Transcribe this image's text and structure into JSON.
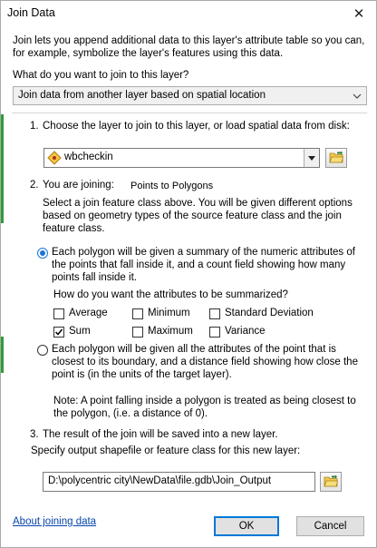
{
  "window": {
    "title": "Join Data",
    "close_glyph": "✕"
  },
  "intro": "Join lets you append additional data to this layer's attribute table so you can, for example, symbolize the layer's features using this data.",
  "question": "What do you want to join to this layer?",
  "join_type": {
    "selected": "Join data from another layer based on spatial location"
  },
  "step1": {
    "number": "1.",
    "label": "Choose the layer to join to this layer, or load spatial data from disk:",
    "layer": {
      "selected": "wbcheckin"
    }
  },
  "step2": {
    "number": "2.",
    "label": "You are joining:",
    "join_kind": "Points to Polygons",
    "description": "Select a join feature class above.  You will be given different options based on geometry types of the source feature class and the join feature class.",
    "option_summary": {
      "selected": true,
      "text": "Each polygon will be given a summary of the numeric attributes of the points that fall inside it, and a count field showing how many points fall inside it."
    },
    "summarize_question": "How do you want the attributes to be summarized?",
    "stats": [
      {
        "label": "Average",
        "checked": false
      },
      {
        "label": "Minimum",
        "checked": false
      },
      {
        "label": "Standard Deviation",
        "checked": false
      },
      {
        "label": "Sum",
        "checked": true
      },
      {
        "label": "Maximum",
        "checked": false
      },
      {
        "label": "Variance",
        "checked": false
      }
    ],
    "option_closest": {
      "selected": false,
      "text": "Each polygon will be given all the attributes of the point that is closest to its boundary, and a distance field showing how close the point is (in the units of the target layer)."
    },
    "note": "Note: A point falling inside a polygon is treated as being closest to the polygon, (i.e. a distance of 0)."
  },
  "step3": {
    "number": "3.",
    "label": "The result of the join will be saved into a new layer.",
    "output_label": "Specify output shapefile or feature class for this new layer:",
    "output_path": "D:\\polycentric city\\NewData\\file.gdb\\Join_Output"
  },
  "footer": {
    "about_link": "About joining data",
    "ok_label": "OK",
    "cancel_label": "Cancel"
  },
  "colors": {
    "accent": "#0078d7",
    "side_bar": "#2f9b3a",
    "link": "#0645ad"
  }
}
